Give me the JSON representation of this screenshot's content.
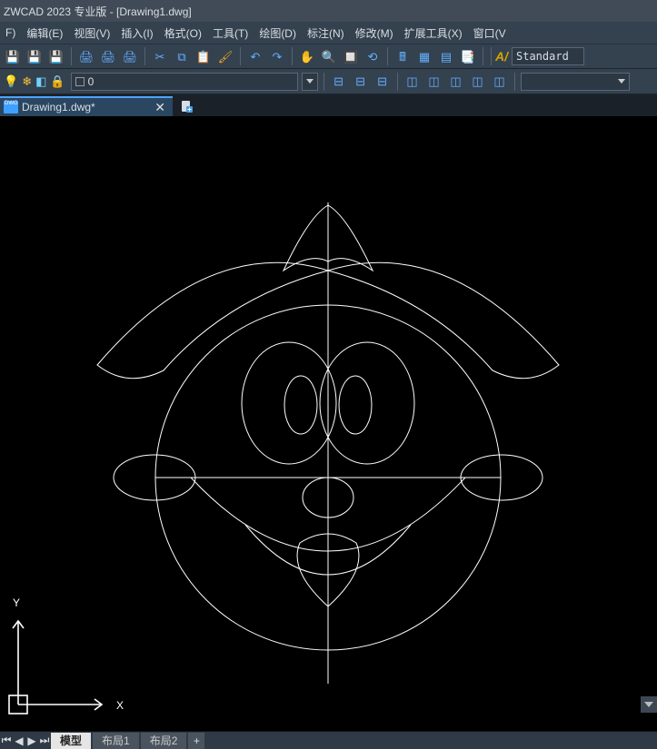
{
  "titlebar": {
    "text": "ZWCAD 2023 专业版 - [Drawing1.dwg]"
  },
  "menu": {
    "items": [
      "F)",
      "编辑(E)",
      "视图(V)",
      "插入(I)",
      "格式(O)",
      "工具(T)",
      "绘图(D)",
      "标注(N)",
      "修改(M)",
      "扩展工具(X)",
      "窗口(V"
    ]
  },
  "layer": {
    "current": "0",
    "textstyle_prefix": "A/",
    "textstyle_value": "Standard"
  },
  "doc_tabs": {
    "active": {
      "name": "Drawing1.dwg*"
    }
  },
  "ucs": {
    "x_label": "X",
    "y_label": "Y"
  },
  "layout_tabs": {
    "tabs": [
      "模型",
      "布局1",
      "布局2"
    ],
    "selected": 0
  }
}
